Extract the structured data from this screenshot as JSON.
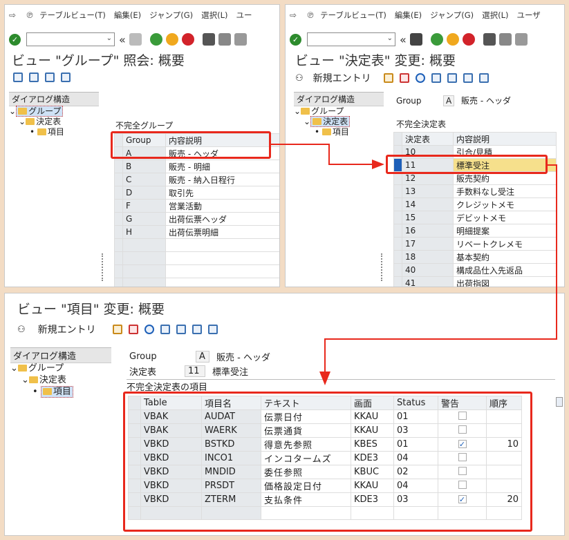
{
  "top_left": {
    "menu": [
      "テーブルビュー(T)",
      "編集(E)",
      "ジャンプ(G)",
      "選択(L)",
      "ユー"
    ],
    "title": "ビュー \"グループ\" 照会: 概要",
    "tree_header": "ダイアログ構造",
    "tree": [
      "グループ",
      "決定表",
      "項目"
    ],
    "table_caption": "不完全グループ",
    "columns": [
      "Group",
      "内容説明"
    ],
    "rows": [
      [
        "A",
        "販売 - ヘッダ"
      ],
      [
        "B",
        "販売 - 明細"
      ],
      [
        "C",
        "販売 - 納入日程行"
      ],
      [
        "D",
        "取引先"
      ],
      [
        "F",
        "営業活動"
      ],
      [
        "G",
        "出荷伝票ヘッダ"
      ],
      [
        "H",
        "出荷伝票明細"
      ]
    ]
  },
  "top_right": {
    "menu": [
      "テーブルビュー(T)",
      "編集(E)",
      "ジャンプ(G)",
      "選択(L)",
      "ユーザ"
    ],
    "title": "ビュー \"決定表\" 変更: 概要",
    "new_entry": "新規エントリ",
    "tree_header": "ダイアログ構造",
    "tree": [
      "グループ",
      "決定表",
      "項目"
    ],
    "group_label": "Group",
    "group_value": "A",
    "group_desc": "販売 - ヘッダ",
    "table_caption": "不完全決定表",
    "columns": [
      "決定表",
      "内容説明"
    ],
    "rows": [
      [
        "10",
        "引合/見積"
      ],
      [
        "11",
        "標準受注"
      ],
      [
        "12",
        "販売契約"
      ],
      [
        "13",
        "手数料なし受注"
      ],
      [
        "14",
        "クレジットメモ"
      ],
      [
        "15",
        "デビットメモ"
      ],
      [
        "16",
        "明細提案"
      ],
      [
        "17",
        "リベートクレメモ"
      ],
      [
        "18",
        "基本契約"
      ],
      [
        "40",
        "構成品仕入先返品"
      ],
      [
        "41",
        "出荷指図"
      ]
    ]
  },
  "bottom": {
    "title": "ビュー \"項目\" 変更: 概要",
    "new_entry": "新規エントリ",
    "tree_header": "ダイアログ構造",
    "tree": [
      "グループ",
      "決定表",
      "項目"
    ],
    "group_label": "Group",
    "group_value": "A",
    "group_desc": "販売 - ヘッダ",
    "table_label": "決定表",
    "table_value": "11",
    "table_desc": "標準受注",
    "table_caption": "不完全決定表の項目",
    "columns": [
      "Table",
      "項目名",
      "テキスト",
      "画面",
      "Status",
      "警告",
      "順序"
    ],
    "rows": [
      [
        "VBAK",
        "AUDAT",
        "伝票日付",
        "KKAU",
        "01",
        false,
        ""
      ],
      [
        "VBAK",
        "WAERK",
        "伝票通貨",
        "KKAU",
        "03",
        false,
        ""
      ],
      [
        "VBKD",
        "BSTKD",
        "得意先参照",
        "KBES",
        "01",
        true,
        "10"
      ],
      [
        "VBKD",
        "INCO1",
        "インコタームズ",
        "KDE3",
        "04",
        false,
        ""
      ],
      [
        "VBKD",
        "MNDID",
        "委任参照",
        "KBUC",
        "02",
        false,
        ""
      ],
      [
        "VBKD",
        "PRSDT",
        "価格設定日付",
        "KKAU",
        "04",
        false,
        ""
      ],
      [
        "VBKD",
        "ZTERM",
        "支払条件",
        "KDE3",
        "03",
        true,
        "20"
      ]
    ]
  },
  "colors": {
    "highlight": "#e8281c",
    "accent": "#1d5fb8",
    "yellow_row": "#f6e08c"
  }
}
